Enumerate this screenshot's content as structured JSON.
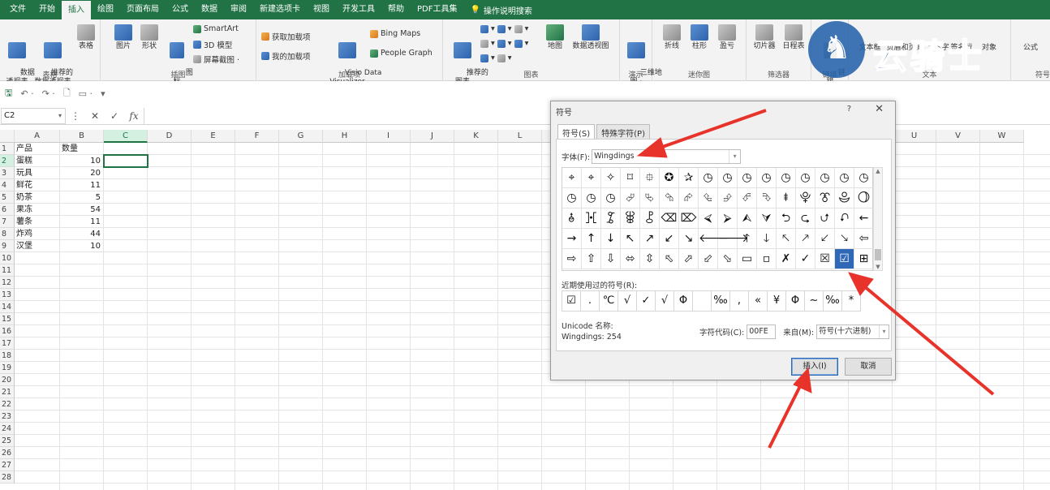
{
  "ribbon_tabs": [
    "文件",
    "开始",
    "插入",
    "绘图",
    "页面布局",
    "公式",
    "数据",
    "审阅",
    "新建选项卡",
    "视图",
    "开发工具",
    "帮助",
    "PDF工具集"
  ],
  "active_tab": "插入",
  "tell_me": "操作说明搜索",
  "groups": {
    "tables": {
      "label": "表格",
      "btn_pivot": "数据\n透视表",
      "btn_rec_pivot": "推荐的\n数据透视表",
      "btn_table": "表格"
    },
    "illustrations": {
      "label": "插图",
      "btn_picture": "图片",
      "btn_shapes": "形状",
      "btn_icons": "图\n标",
      "smartart": "SmartArt",
      "model3d": "3D 模型",
      "screenshot": "屏幕截图 ·"
    },
    "addins": {
      "label": "加载项",
      "get": "获取加载项",
      "mine": "我的加载项",
      "visio": "Visio Data\nVisualizer",
      "bing": "Bing Maps",
      "people": "People Graph"
    },
    "charts": {
      "label": "图表",
      "recommended": "推荐的\n图表",
      "map": "地图",
      "pivotchart": "数据透视图"
    },
    "tours": {
      "label": "演示",
      "map3d": "三维地\n图 ·"
    },
    "sparklines": {
      "label": "迷你图",
      "line": "折线",
      "column": "柱形",
      "winloss": "盈亏"
    },
    "filters": {
      "label": "筛选器",
      "slicer": "切片器",
      "timeline": "日程表"
    },
    "links": {
      "label": "链接",
      "link": "链\n接"
    },
    "text": {
      "label": "文本",
      "textbox": "文本框",
      "headerfooter": "页眉和页脚",
      "wordart": "艺术字",
      "signature": "签名行",
      "object": "对象"
    },
    "symbols": {
      "label": "符号",
      "equation": "公式"
    }
  },
  "watermark": {
    "text": "云骑士"
  },
  "namebox": "C2",
  "columns": [
    "A",
    "B",
    "C",
    "D",
    "E",
    "F",
    "G",
    "H",
    "I",
    "J",
    "K",
    "L",
    "M",
    "N",
    "O",
    "P",
    "Q",
    "R",
    "S",
    "T",
    "U",
    "V",
    "W"
  ],
  "rows": [
    "1",
    "2",
    "3",
    "4",
    "5",
    "6",
    "7",
    "8",
    "9",
    "10",
    "11",
    "12",
    "13",
    "14",
    "15",
    "16",
    "17",
    "18",
    "19",
    "20",
    "21",
    "22",
    "23",
    "24",
    "25",
    "26",
    "27",
    "28"
  ],
  "sheet": {
    "header": [
      "产品",
      "数量"
    ],
    "data": [
      [
        "蛋糕",
        "10"
      ],
      [
        "玩具",
        "20"
      ],
      [
        "鲜花",
        "11"
      ],
      [
        "奶茶",
        "5"
      ],
      [
        "果冻",
        "54"
      ],
      [
        "薯条",
        "11"
      ],
      [
        "炸鸡",
        "44"
      ],
      [
        "汉堡",
        "10"
      ]
    ]
  },
  "dialog": {
    "title": "符号",
    "help": "?",
    "close": "✕",
    "tab_symbols": "符号(S)",
    "tab_special": "特殊字符(P)",
    "font_label": "字体(F):",
    "font_value": "Wingdings",
    "symbols": [
      "⌖",
      "⌖",
      "✧",
      "⌑",
      "⯐",
      "✪",
      "✰",
      "◷",
      "◷",
      "◷",
      "◷",
      "◷",
      "◷",
      "◷",
      "◷",
      "◷",
      "◷",
      "◷",
      "◷",
      "⮰",
      "⮱",
      "⮲",
      "⮳",
      "⮴",
      "⮵",
      "⮶",
      "⮷",
      "⯒",
      "⯓",
      "⯔",
      "⯕",
      "⯖",
      "⯗",
      "⯘",
      "⯙",
      "⯚",
      "⯛",
      "⌫",
      "⌦",
      "⮘",
      "⮚",
      "⮙",
      "⮛",
      "⮌",
      "⮎",
      "⮍",
      "⮏",
      "←",
      "→",
      "↑",
      "↓",
      "↖",
      "↗",
      "↙",
      "↘",
      "🡐",
      "🡒",
      "🡑",
      "🡓",
      "🡔",
      "🡕",
      "🡗",
      "🡖",
      "⇦",
      "⇨",
      "⇧",
      "⇩",
      "⬄",
      "⇳",
      "⬁",
      "⬀",
      "⬃",
      "⬂",
      "▭",
      "▫",
      "✗",
      "✓",
      "☒",
      "☑",
      "⊞"
    ],
    "selected_index": 78,
    "recent_label": "近期使用过的符号(R):",
    "recent": [
      "☑",
      ".",
      "℃",
      "√",
      "✓",
      "√",
      "Φ",
      "",
      "‰",
      ",",
      "«",
      "¥",
      "Φ",
      "~",
      "‰",
      "*"
    ],
    "unicode_label": "Unicode 名称:",
    "unicode_value": "Wingdings: 254",
    "code_label": "字符代码(C):",
    "code_value": "00FE",
    "from_label": "来自(M):",
    "from_value": "符号(十六进制)",
    "insert": "插入(I)",
    "cancel": "取消"
  },
  "colors": {
    "excel_green": "#217346",
    "arrow_red": "#e8332a",
    "selection_blue": "#2f68b7"
  }
}
